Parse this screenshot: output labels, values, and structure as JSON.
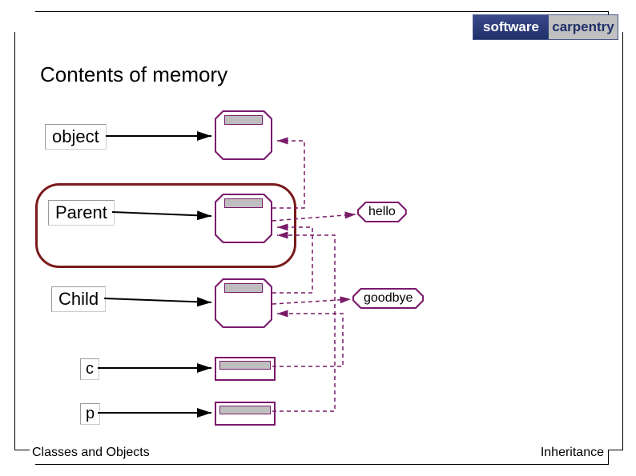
{
  "logo": {
    "left": "software",
    "right": "carpentry"
  },
  "title": "Contents of memory",
  "labels": {
    "object": "object",
    "parent": "Parent",
    "child": "Child",
    "c": "c",
    "p": "p"
  },
  "methods": {
    "hello": "hello",
    "goodbye": "goodbye"
  },
  "footer": {
    "left": "Classes and Objects",
    "right": "Inheritance"
  },
  "colors": {
    "purple": "#7a1a6a",
    "darkred": "#7a1a1a",
    "grey": "#bfbfbf"
  }
}
